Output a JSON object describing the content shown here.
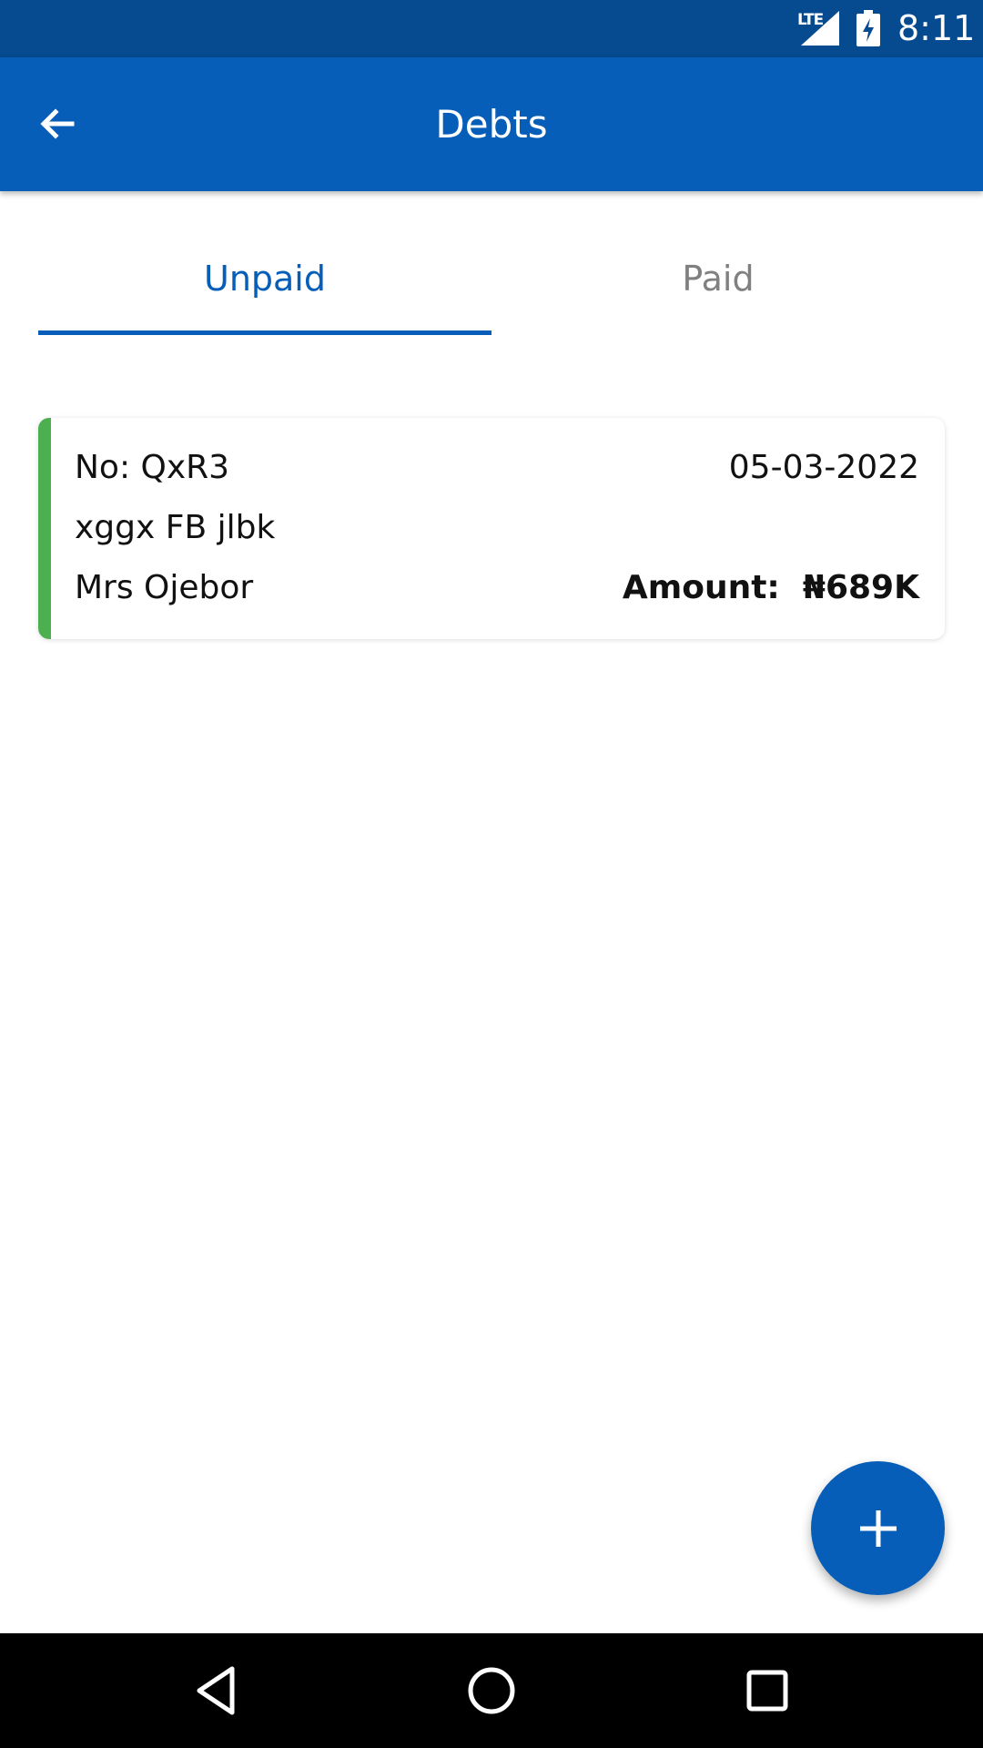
{
  "status_bar": {
    "network": "LTE",
    "time": "8:11",
    "icons": [
      "signal-icon",
      "battery-charging-icon"
    ]
  },
  "app_bar": {
    "title": "Debts",
    "back_icon": "arrow-back-icon"
  },
  "tabs": [
    {
      "label": "Unpaid",
      "selected": true
    },
    {
      "label": "Paid",
      "selected": false
    }
  ],
  "debts": [
    {
      "number": "No: QxR3",
      "date": "05-03-2022",
      "description": "xggx FB jlbk",
      "customer": "Mrs Ojebor",
      "amount_label": "Amount:",
      "amount": "₦689K",
      "status_color": "#4caf50"
    }
  ],
  "fab": {
    "icon": "plus-icon"
  },
  "nav_bar": {
    "icons": [
      "nav-back-icon",
      "nav-home-icon",
      "nav-recents-icon"
    ]
  },
  "colors": {
    "primary": "#065eb8",
    "status_bar": "#064a8f",
    "tab_inactive": "#808080",
    "accent_unpaid": "#4caf50"
  }
}
